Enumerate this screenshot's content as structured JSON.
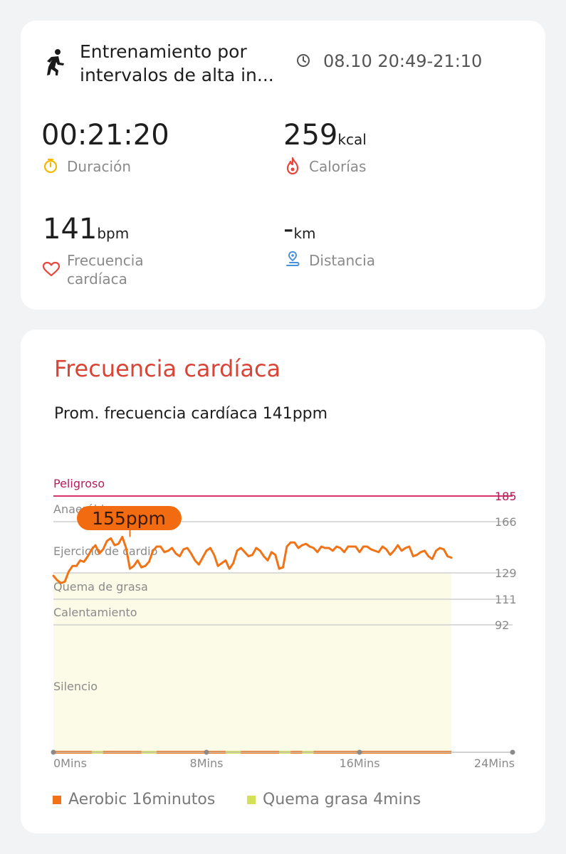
{
  "summary": {
    "workout_title": "Entrenamiento por intervalos de alta in...",
    "time_range": "08.10 20:49-21:10",
    "duration_value": "00:21:20",
    "duration_label": "Duración",
    "calories_value": "259",
    "calories_unit": "kcal",
    "calories_label": "Calorías",
    "heart_rate_value": "141",
    "heart_rate_unit": "bpm",
    "heart_rate_label_line1": "Frecuencia",
    "heart_rate_label_line2": "cardíaca",
    "distance_value": "-",
    "distance_unit": "km",
    "distance_label": "Distancia",
    "icons": {
      "workout": "running-person-icon",
      "time": "clock-icon",
      "duration": "stopwatch-icon",
      "calories": "flame-icon",
      "heart_rate": "heart-icon",
      "distance": "location-route-icon"
    }
  },
  "heart_rate_card": {
    "title": "Frecuencia cardíaca",
    "average_text": "Prom. frecuencia cardíaca 141ppm",
    "colors": {
      "title": "#d94436",
      "line": "#f07318",
      "danger": "#d6336c",
      "aerobic": "#f07318",
      "fat_burn": "#d4e157"
    }
  },
  "chart_data": {
    "type": "line",
    "title": "",
    "xlabel": "",
    "ylabel": "",
    "x_ticks": [
      "0Mins",
      "8Mins",
      "16Mins",
      "24Mins"
    ],
    "xlim": [
      0,
      24
    ],
    "zones": [
      {
        "name": "Peligroso",
        "threshold": 185
      },
      {
        "name": "Anaeróbico",
        "threshold": 166
      },
      {
        "name": "Ejercicio de cardio",
        "threshold": 129
      },
      {
        "name": "Quema de grasa",
        "threshold": 111
      },
      {
        "name": "Calentamiento",
        "threshold": 92
      },
      {
        "name": "Silencio",
        "threshold": null
      }
    ],
    "highlight_label": "155ppm",
    "highlight": {
      "x": 4.0,
      "y": 155
    },
    "series": [
      {
        "x": [
          0.0,
          0.2,
          0.4,
          0.6,
          0.8,
          1.0,
          1.2,
          1.4,
          1.6,
          1.8,
          2.0,
          2.2,
          2.4,
          2.6,
          2.8,
          3.0,
          3.2,
          3.4,
          3.6,
          3.8,
          4.0,
          4.2,
          4.4,
          4.6,
          4.8,
          5.0,
          5.2,
          5.4,
          5.6,
          5.8,
          6.0,
          6.2,
          6.4,
          6.6,
          6.8,
          7.0,
          7.2,
          7.4,
          7.6,
          7.8,
          8.0,
          8.2,
          8.4,
          8.6,
          8.8,
          9.0,
          9.2,
          9.4,
          9.6,
          9.8,
          10.0,
          10.2,
          10.4,
          10.6,
          10.8,
          11.0,
          11.2,
          11.4,
          11.6,
          11.8,
          12.0,
          12.2,
          12.4,
          12.6,
          12.8,
          13.0,
          13.2,
          13.4,
          13.6,
          13.8,
          14.0,
          14.2,
          14.4,
          14.6,
          14.8,
          15.0,
          15.2,
          15.4,
          15.6,
          15.8,
          16.0,
          16.2,
          16.4,
          16.6,
          16.8,
          17.0,
          17.2,
          17.4,
          17.6,
          17.8,
          18.0,
          18.2,
          18.4,
          18.6,
          18.8,
          19.0,
          19.2,
          19.4,
          19.6,
          19.8,
          20.0,
          20.2,
          20.4,
          20.6,
          20.8
        ],
        "values": [
          127,
          124,
          122,
          123,
          130,
          134,
          134,
          138,
          137,
          141,
          146,
          149,
          143,
          146,
          152,
          154,
          149,
          150,
          155,
          147,
          132,
          134,
          138,
          133,
          134,
          137,
          145,
          148,
          148,
          144,
          145,
          147,
          143,
          141,
          146,
          147,
          143,
          138,
          135,
          140,
          145,
          147,
          142,
          134,
          136,
          138,
          132,
          136,
          145,
          147,
          144,
          141,
          142,
          147,
          145,
          141,
          138,
          144,
          142,
          132,
          133,
          148,
          151,
          151,
          147,
          149,
          150,
          148,
          147,
          144,
          148,
          147,
          147,
          145,
          148,
          147,
          144,
          148,
          148,
          148,
          144,
          148,
          148,
          146,
          145,
          144,
          148,
          146,
          142,
          145,
          149,
          145,
          147,
          148,
          141,
          142,
          144,
          145,
          141,
          139,
          145,
          147,
          146,
          141,
          140
        ]
      }
    ],
    "legend": [
      {
        "name": "Aerobic 16minutos",
        "color": "#f07318"
      },
      {
        "name": "Quema grasa 4mins",
        "color": "#d4e157"
      }
    ]
  }
}
